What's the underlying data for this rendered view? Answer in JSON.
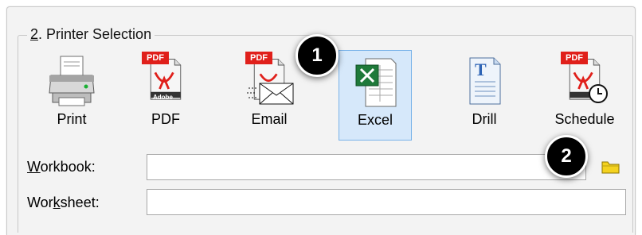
{
  "printer_selection": {
    "number": "2",
    "title": ". Printer Selection",
    "tools": [
      {
        "label": "Print",
        "icon": "printer-icon"
      },
      {
        "label": "PDF",
        "icon": "pdf-icon",
        "badge_text": "PDF",
        "brand_text": "Adobe"
      },
      {
        "label": "Email",
        "icon": "email-pdf-icon",
        "badge_text": "PDF"
      },
      {
        "label": "Excel",
        "icon": "excel-icon",
        "selected": true
      },
      {
        "label": "Drill",
        "icon": "drill-document-icon"
      },
      {
        "label": "Schedule",
        "icon": "schedule-pdf-icon",
        "badge_text": "PDF"
      }
    ]
  },
  "fields": {
    "workbook": {
      "label_prefix": "",
      "label_underlined": "W",
      "label_suffix": "orkbook:",
      "value": ""
    },
    "worksheet": {
      "label_prefix": "Wor",
      "label_underlined": "k",
      "label_suffix": "sheet:",
      "value": ""
    }
  },
  "callouts": {
    "first": "1",
    "second": "2"
  },
  "colors": {
    "selection": "#d6e8fa",
    "pdf_red": "#e0201b",
    "excel_green": "#1f7a3a",
    "folder_yellow": "#f4d21f"
  }
}
